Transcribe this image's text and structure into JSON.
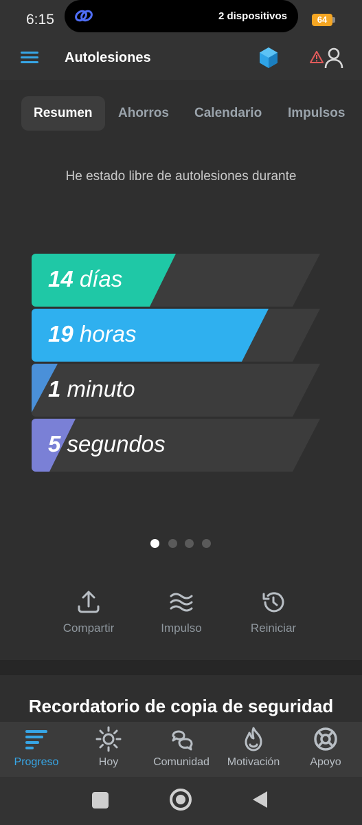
{
  "status_bar": {
    "time": "6:15",
    "devices": "2 dispositivos",
    "battery": "64",
    "battery_color": "#f5a623"
  },
  "header": {
    "title": "Autolesiones",
    "menu_icon": "hamburger-menu-icon",
    "right_icons": [
      "hexagon-app-icon",
      "warning-icon",
      "user-icon"
    ]
  },
  "tabs": [
    {
      "label": "Resumen",
      "active": true
    },
    {
      "label": "Ahorros",
      "active": false
    },
    {
      "label": "Calendario",
      "active": false
    },
    {
      "label": "Impulsos",
      "active": false
    }
  ],
  "summary": {
    "headline": "He estado libre de autolesiones durante",
    "counters": [
      {
        "value": "14",
        "unit": "días",
        "color": "#1fc8a6"
      },
      {
        "value": "19",
        "unit": "horas",
        "color": "#2fb0ef"
      },
      {
        "value": "1",
        "unit": "minuto",
        "color": "#4a90d9"
      },
      {
        "value": "5",
        "unit": "segundos",
        "color": "#7a80d6"
      }
    ],
    "page_indicator": {
      "total": 4,
      "current": 1
    }
  },
  "actions": [
    {
      "label": "Compartir",
      "icon": "share-upload-icon"
    },
    {
      "label": "Impulso",
      "icon": "waves-icon"
    },
    {
      "label": "Reiniciar",
      "icon": "history-reset-icon"
    }
  ],
  "reminder": {
    "title": "Recordatorio de copia de seguridad"
  },
  "bottom_nav": [
    {
      "label": "Progreso",
      "icon": "progress-bars-icon",
      "active": true
    },
    {
      "label": "Hoy",
      "icon": "sun-icon",
      "active": false
    },
    {
      "label": "Comunidad",
      "icon": "community-chat-icon",
      "active": false
    },
    {
      "label": "Motivación",
      "icon": "flame-icon",
      "active": false
    },
    {
      "label": "Apoyo",
      "icon": "lifebuoy-icon",
      "active": false
    }
  ],
  "colors": {
    "accent": "#37a6e6",
    "background": "#2f2f2f"
  }
}
